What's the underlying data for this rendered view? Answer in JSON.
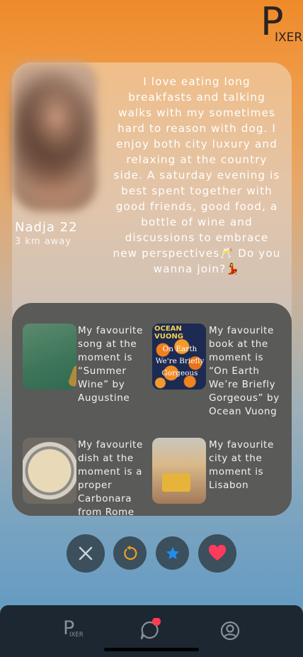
{
  "app": {
    "logo_letter": "P",
    "logo_rest": "IXER"
  },
  "profile": {
    "name": "Nadja 22",
    "distance": "3 km away",
    "bio": "I love eating long breakfasts and talking walks with my sometimes hard to reason with dog. I enjoy both city luxury and relaxing at the country side. A saturday evening is best spent together with good friends, good food, a bottle of wine and discussions to embrace new perspectives🥂 Do you wanna join?💃"
  },
  "facts": [
    {
      "icon": "album-cover",
      "text": "My favourite song at the moment is “Summer Wine” by Augustine"
    },
    {
      "icon": "book-cover",
      "text": "My favourite book at the moment is “On Earth We’re Briefly Gorgeous” by Ocean Vuong",
      "cover_author": "OCEAN VUONG",
      "cover_title": "On Earth We're Briefly Gorgeous"
    },
    {
      "icon": "pasta-dish-photo",
      "text": "My favourite dish at the moment is a proper Carbonara from Rome"
    },
    {
      "icon": "lisbon-tram-photo",
      "text": "My favourite city at the moment is Lisabon"
    }
  ],
  "actions": [
    {
      "icon": "close-icon",
      "color": "#c9d2d8"
    },
    {
      "icon": "rewind-icon",
      "color": "#f0a020"
    },
    {
      "icon": "star-icon",
      "color": "#1e8ff0"
    },
    {
      "icon": "heart-icon",
      "color": "#ff3b5c"
    }
  ],
  "tabbar": {
    "tabs": [
      "home-logo-icon",
      "chat-icon",
      "profile-icon"
    ],
    "chat_badge_color": "#ff3b4e",
    "tab_logo_letter": "P",
    "tab_logo_rest": "IXER"
  },
  "colors": {
    "facts_card_bg": "#5a5a58",
    "tabbar_bg": "#1c2732",
    "button_bg": "#3c4f5c"
  }
}
